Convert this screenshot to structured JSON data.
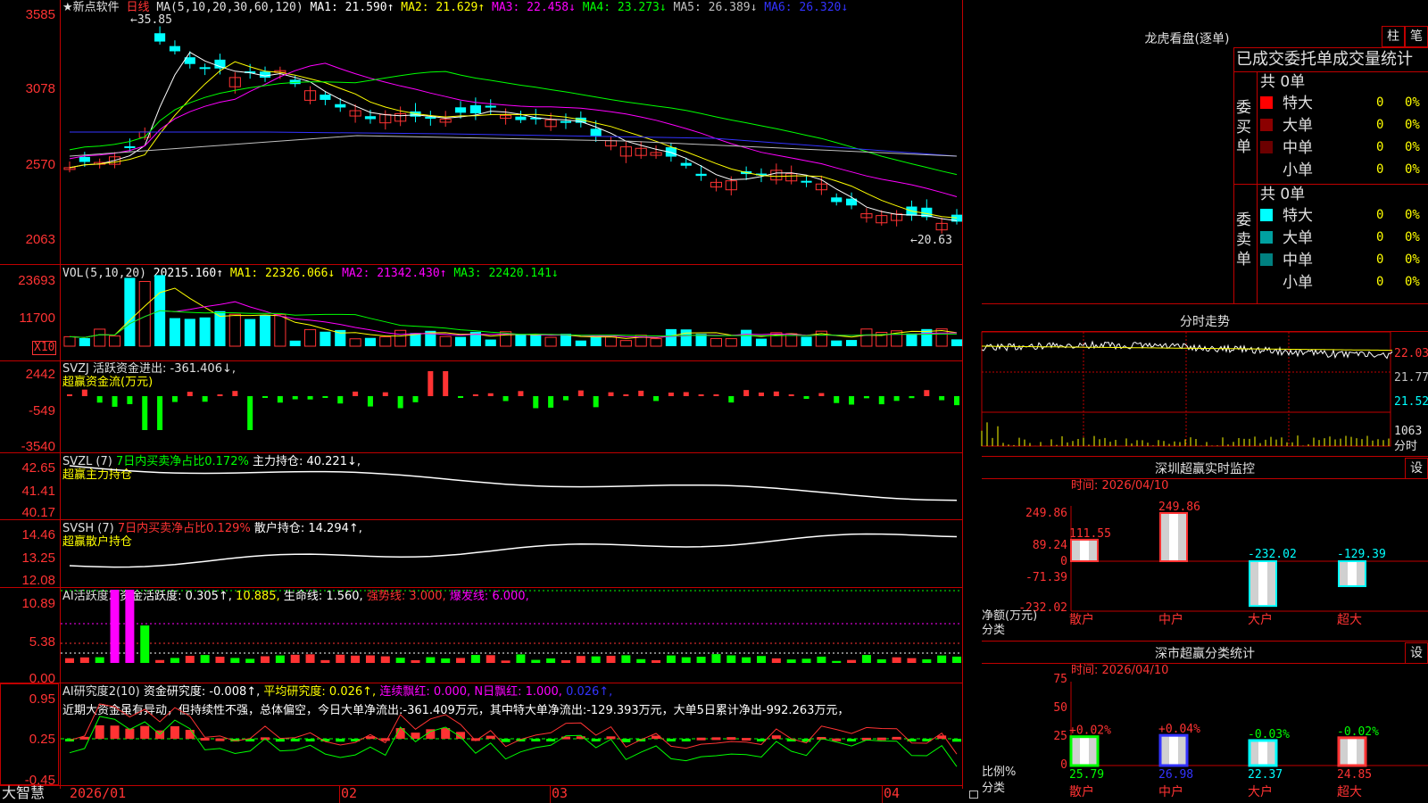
{
  "colors": {
    "up": "#ff3333",
    "down": "#00ffff",
    "white": "#ffffff",
    "yellow": "#ffff00",
    "magenta": "#ff00ff",
    "green": "#00ff00",
    "blue": "#3333ff",
    "frame": "#c00000"
  },
  "main_chart": {
    "header": {
      "name": "★新点软件",
      "period": "日线",
      "ma_def": "MA(5,10,20,30,60,120)",
      "ma1": "MA1: 21.590↑",
      "ma2": "MA2: 21.629↑",
      "ma3": "MA3: 22.458↓",
      "ma4": "MA4: 23.273↓",
      "ma5": "MA5: 26.389↓",
      "ma6": "MA6: 26.320↓"
    },
    "high_label": "35.85",
    "low_label": "20.63",
    "y_ticks": [
      "3585",
      "3078",
      "2570",
      "2063"
    ]
  },
  "vol_panel": {
    "header": {
      "def": "VOL(5,10,20)",
      "value": "20215.160↑",
      "ma1": "MA1: 22326.066↓",
      "ma2": "MA2: 21342.430↑",
      "ma3": "MA3: 22420.141↓"
    },
    "y_ticks": [
      "23693",
      "11700"
    ],
    "unit": "X10"
  },
  "svzj_panel": {
    "header": "SVZJ  活跃资金进出: -361.406↓,",
    "subtitle": "超赢资金流(万元)",
    "y_ticks": [
      "2442",
      "-549",
      "-3540"
    ]
  },
  "svzl_panel": {
    "header_a": "SVZL (7)",
    "header_b": "7日内买卖净占比0.172%",
    "header_c": "主力持仓: 40.221↓,",
    "subtitle": "超赢主力持仓",
    "y_ticks": [
      "42.65",
      "41.41",
      "40.17"
    ]
  },
  "svsh_panel": {
    "header_a": "SVSH (7)",
    "header_b": "7日内买卖净占比0.129%",
    "header_c": "散户持仓: 14.294↑,",
    "subtitle": "超赢散户持仓",
    "y_ticks": [
      "14.46",
      "13.25",
      "12.08"
    ]
  },
  "ai_act_panel": {
    "header_a": "AI活跃度2",
    "header_b": "资金活跃度: 0.305↑,",
    "header_c": "10.885,",
    "header_d": "生命线: 1.560,",
    "header_e": "强势线: 3.000,",
    "header_f": "爆发线: 6.000,",
    "y_ticks": [
      "10.89",
      "5.38",
      "0.00"
    ]
  },
  "ai_res_panel": {
    "header_a": "AI研究度2(10)",
    "header_b": "资金研究度: -0.008↑,",
    "header_c": "平均研究度: 0.026↑,",
    "header_d": "连续飘红: 0.000,",
    "header_e": "N日飘红: 1.000,",
    "header_f": "0.026↑,",
    "comment": "近期大资金虽有异动，但持续性不强，总体偏空，今日大单净流出:-361.409万元，其中特大单净流出:-129.393万元，大单5日累计净出-992.263万元，",
    "y_ticks": [
      "0.95",
      "0.25",
      "-0.45"
    ]
  },
  "x_axis": [
    "2026/01",
    "02",
    "03",
    "04"
  ],
  "bottom_left": "大智慧",
  "right_panel": {
    "lhb_title": "龙虎看盘(逐单)",
    "btn_bar": "柱",
    "btn_note": "笔",
    "order_title": "已成交委托单成交量统计",
    "buy": {
      "side_label": "委买单",
      "total": "共 0单",
      "rows": [
        {
          "label": "特大",
          "count": "0",
          "pct": "0%"
        },
        {
          "label": "大单",
          "count": "0",
          "pct": "0%"
        },
        {
          "label": "中单",
          "count": "0",
          "pct": "0%"
        },
        {
          "label": "小单",
          "count": "0",
          "pct": "0%"
        }
      ]
    },
    "sell": {
      "side_label": "委卖单",
      "total": "共 0单",
      "rows": [
        {
          "label": "特大",
          "count": "0",
          "pct": "0%"
        },
        {
          "label": "大单",
          "count": "0",
          "pct": "0%"
        },
        {
          "label": "中单",
          "count": "0",
          "pct": "0%"
        },
        {
          "label": "小单",
          "count": "0",
          "pct": "0%"
        }
      ]
    },
    "intraday_title": "分时走势",
    "intraday_ticks": [
      "22.03",
      "21.77",
      "21.52"
    ],
    "intraday_vol": "1063",
    "intraday_unit": "分时",
    "monitor_title": "深圳超赢实时监控",
    "monitor_btn": "设",
    "monitor_time": "时间: 2026/04/10",
    "monitor_ticks": [
      "249.86",
      "89.24",
      "0",
      "-71.39",
      "-232.02"
    ],
    "monitor_ylabel": "净额(万元)",
    "monitor_xlabel": "分类",
    "monitor_values": [
      "111.55",
      "249.86",
      "-232.02",
      "-129.39"
    ],
    "monitor_cats": [
      "散户",
      "中户",
      "大户",
      "超大"
    ],
    "stats_title": "深市超赢分类统计",
    "stats_btn": "设",
    "stats_time": "时间: 2026/04/10",
    "stats_ticks": [
      "75",
      "50",
      "25",
      "0"
    ],
    "stats_ylabel": "比例%",
    "stats_xlabel": "分类",
    "stats_changes": [
      "+0.02%",
      "+0.04%",
      "-0.03%",
      "-0.02%"
    ],
    "stats_values": [
      "25.79",
      "26.98",
      "22.37",
      "24.85"
    ],
    "stats_cats": [
      "散户",
      "中户",
      "大户",
      "超大"
    ]
  }
}
